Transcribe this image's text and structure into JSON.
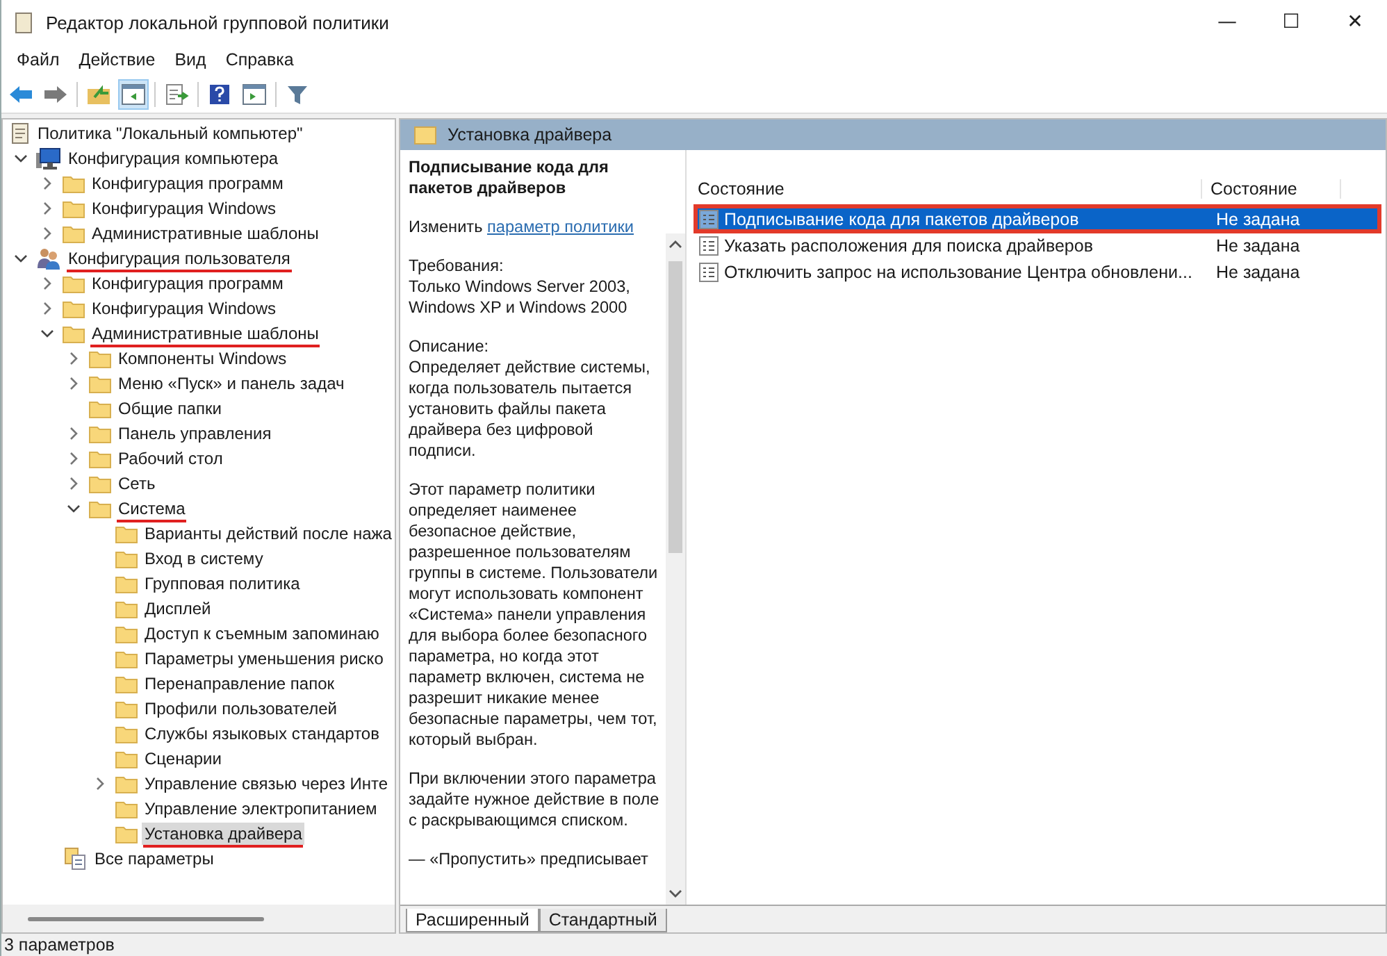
{
  "window": {
    "title": "Редактор локальной групповой политики",
    "controls": [
      "—",
      "☐",
      "✕"
    ]
  },
  "menu": [
    "Файл",
    "Действие",
    "Вид",
    "Справка"
  ],
  "toolbar": [
    [
      {
        "kind": "back",
        "pressed": false
      },
      {
        "kind": "forward",
        "pressed": false
      }
    ],
    [
      {
        "kind": "up",
        "pressed": false
      },
      {
        "kind": "tree",
        "pressed": true
      }
    ],
    [
      {
        "kind": "export",
        "pressed": false
      }
    ],
    [
      {
        "kind": "help",
        "pressed": false
      },
      {
        "kind": "view",
        "pressed": false
      }
    ],
    [
      {
        "kind": "filter",
        "pressed": false
      }
    ]
  ],
  "tree": [
    {
      "label": "Политика \"Локальный компьютер\"",
      "kind": "document",
      "selected": false,
      "annotated": false,
      "children": [
        {
          "label": "Конфигурация компьютера",
          "kind": "computer",
          "expanded": true,
          "selected": false,
          "annotated": false,
          "children": [
            {
              "label": "Конфигурация программ",
              "kind": "folder",
              "expanded": false,
              "selected": false,
              "annotated": false
            },
            {
              "label": "Конфигурация Windows",
              "kind": "folder",
              "expanded": false,
              "selected": false,
              "annotated": false
            },
            {
              "label": "Административные шаблоны",
              "kind": "folder",
              "expanded": false,
              "selected": false,
              "annotated": false
            }
          ]
        },
        {
          "label": "Конфигурация пользователя",
          "kind": "user",
          "expanded": true,
          "selected": false,
          "annotated": true,
          "children": [
            {
              "label": "Конфигурация программ",
              "kind": "folder",
              "expanded": false,
              "selected": false,
              "annotated": false
            },
            {
              "label": "Конфигурация Windows",
              "kind": "folder",
              "expanded": false,
              "selected": false,
              "annotated": false
            },
            {
              "label": "Административные шаблоны",
              "kind": "folder",
              "expanded": true,
              "selected": false,
              "annotated": true,
              "children": [
                {
                  "label": "Компоненты Windows",
                  "kind": "folder",
                  "expanded": false,
                  "selected": false,
                  "annotated": false
                },
                {
                  "label": "Меню «Пуск» и панель задач",
                  "kind": "folder",
                  "expanded": false,
                  "selected": false,
                  "annotated": false
                },
                {
                  "label": "Общие папки",
                  "kind": "folder",
                  "selected": false,
                  "annotated": false
                },
                {
                  "label": "Панель управления",
                  "kind": "folder",
                  "expanded": false,
                  "selected": false,
                  "annotated": false
                },
                {
                  "label": "Рабочий стол",
                  "kind": "folder",
                  "expanded": false,
                  "selected": false,
                  "annotated": false
                },
                {
                  "label": "Сеть",
                  "kind": "folder",
                  "expanded": false,
                  "selected": false,
                  "annotated": false
                },
                {
                  "label": "Система",
                  "kind": "folder",
                  "expanded": true,
                  "selected": false,
                  "annotated": true,
                  "children": [
                    {
                      "label": "Варианты действий после нажа",
                      "kind": "folder",
                      "selected": false,
                      "annotated": false
                    },
                    {
                      "label": "Вход в систему",
                      "kind": "folder",
                      "selected": false,
                      "annotated": false
                    },
                    {
                      "label": "Групповая политика",
                      "kind": "folder",
                      "selected": false,
                      "annotated": false
                    },
                    {
                      "label": "Дисплей",
                      "kind": "folder",
                      "selected": false,
                      "annotated": false
                    },
                    {
                      "label": "Доступ к съемным запоминаю",
                      "kind": "folder",
                      "selected": false,
                      "annotated": false
                    },
                    {
                      "label": "Параметры уменьшения риско",
                      "kind": "folder",
                      "selected": false,
                      "annotated": false
                    },
                    {
                      "label": "Перенаправление папок",
                      "kind": "folder",
                      "selected": false,
                      "annotated": false
                    },
                    {
                      "label": "Профили пользователей",
                      "kind": "folder",
                      "selected": false,
                      "annotated": false
                    },
                    {
                      "label": "Службы языковых стандартов",
                      "kind": "folder",
                      "selected": false,
                      "annotated": false
                    },
                    {
                      "label": "Сценарии",
                      "kind": "folder",
                      "selected": false,
                      "annotated": false
                    },
                    {
                      "label": "Управление связью через Инте",
                      "kind": "folder",
                      "expanded": false,
                      "selected": false,
                      "annotated": false
                    },
                    {
                      "label": "Управление электропитанием",
                      "kind": "folder",
                      "selected": false,
                      "annotated": false
                    },
                    {
                      "label": "Установка драйвера",
                      "kind": "folder",
                      "selected": true,
                      "annotated": true
                    }
                  ]
                }
              ]
            },
            {
              "label": "Все параметры",
              "kind": "settings",
              "selected": false,
              "annotated": false
            }
          ]
        }
      ]
    }
  ],
  "description": {
    "header": "Установка драйвера",
    "title": "Подписывание кода для пакетов драйверов",
    "edit_prefix": "Изменить ",
    "edit_link": "параметр политики",
    "paragraphs": [
      "Требования:\nТолько Windows Server 2003, Windows XP и Windows 2000",
      "Описание:\nОпределяет действие системы, когда пользователь пытается установить файлы пакета драйвера без цифровой подписи.",
      "Этот параметр политики определяет наименее безопасное действие, разрешенное пользователям группы в системе. Пользователи могут использовать компонент «Система» панели управления для выбора более безопасного параметра, но когда этот параметр включен, система не разрешит никакие менее безопасные параметры, чем тот, который выбран.",
      "При включении этого параметра задайте нужное действие в поле с раскрывающимся списком.",
      "—  «Пропустить» предписывает"
    ],
    "tabs": [
      {
        "label": "Расширенный",
        "selected": true
      },
      {
        "label": "Стандартный",
        "selected": false
      }
    ]
  },
  "list": {
    "columns": [
      "Состояние",
      "Состояние"
    ],
    "rows": [
      {
        "name": "Подписывание кода для пакетов драйверов",
        "state": "Не задана",
        "selected": true,
        "annotated": true
      },
      {
        "name": "Указать расположения для поиска драйверов",
        "state": "Не задана",
        "selected": false,
        "annotated": false
      },
      {
        "name": "Отключить запрос на использование Центра обновлени...",
        "state": "Не задана",
        "selected": false,
        "annotated": false
      }
    ]
  },
  "status_bar": "3 параметров"
}
